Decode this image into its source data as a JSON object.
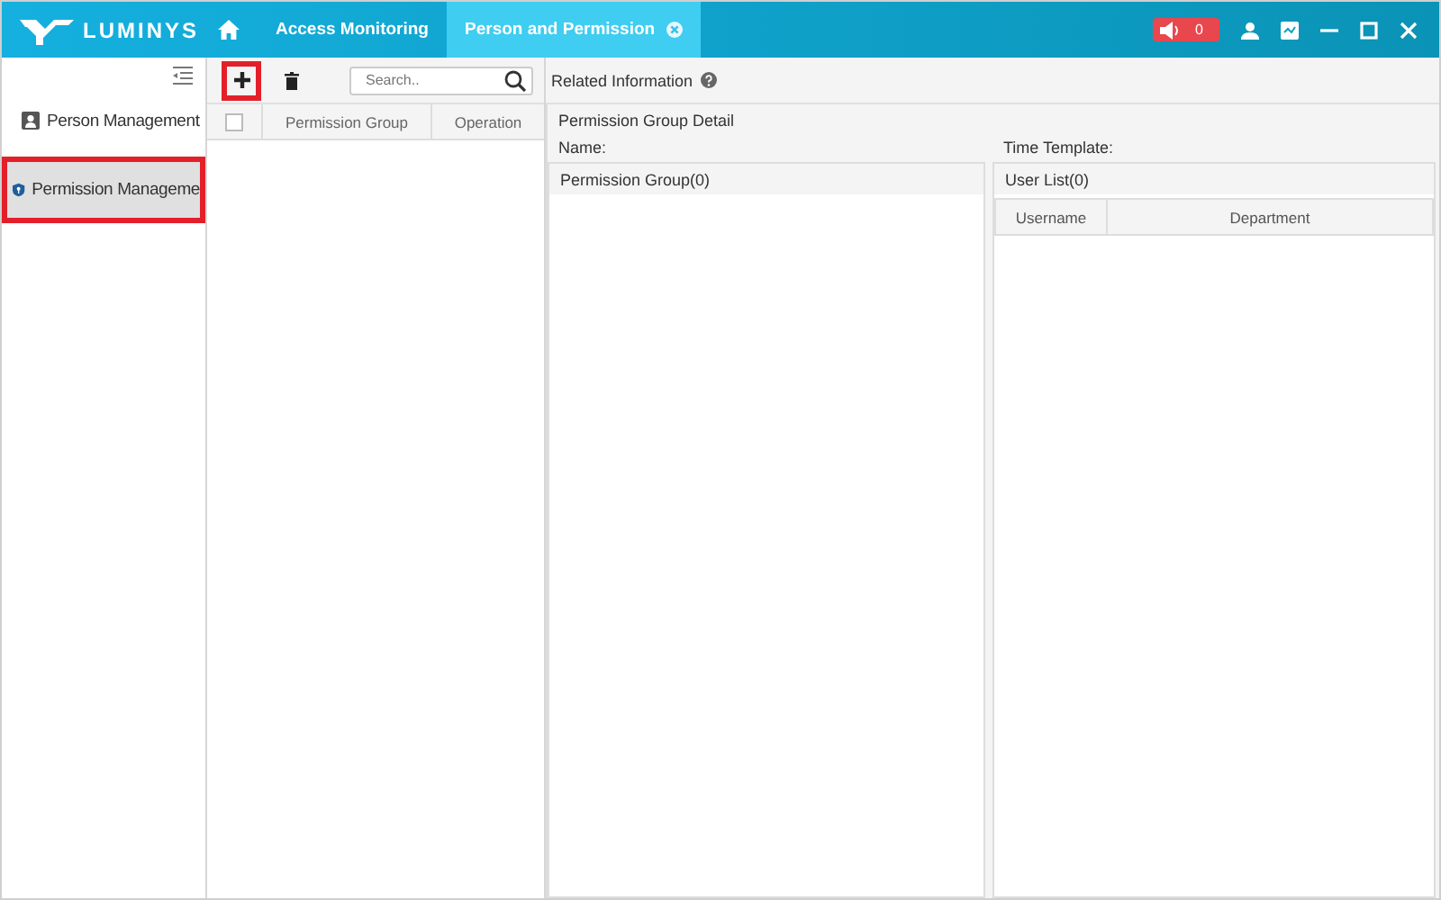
{
  "header": {
    "logo": "LUMINYS",
    "tabs": [
      {
        "kind": "home",
        "selected": false
      },
      {
        "kind": "text",
        "label": "Access Monitoring",
        "selected": false
      },
      {
        "kind": "text",
        "label": "Person and Permission",
        "selected": true,
        "closable": true
      }
    ],
    "alarm_count": "0"
  },
  "sidebar": {
    "items": [
      {
        "kind": "person",
        "label": "Person Management",
        "selected": false,
        "highlighted": false
      },
      {
        "kind": "shield",
        "label": "Permission Manageme",
        "selected": true,
        "highlighted": true
      }
    ]
  },
  "toolbar": {
    "add_highlighted": true,
    "search": {
      "placeholder": "Search.."
    },
    "related": "Related Information"
  },
  "group_table": {
    "columns": [
      "Permission Group",
      "Operation"
    ],
    "all_checked": false
  },
  "detail": {
    "title": "Permission Group Detail",
    "name_label": "Name:",
    "time_label": "Time Template:",
    "groups_title": "Permission Group(0)",
    "users_title": "User List(0)",
    "user_columns": [
      "Username",
      "Department"
    ]
  }
}
